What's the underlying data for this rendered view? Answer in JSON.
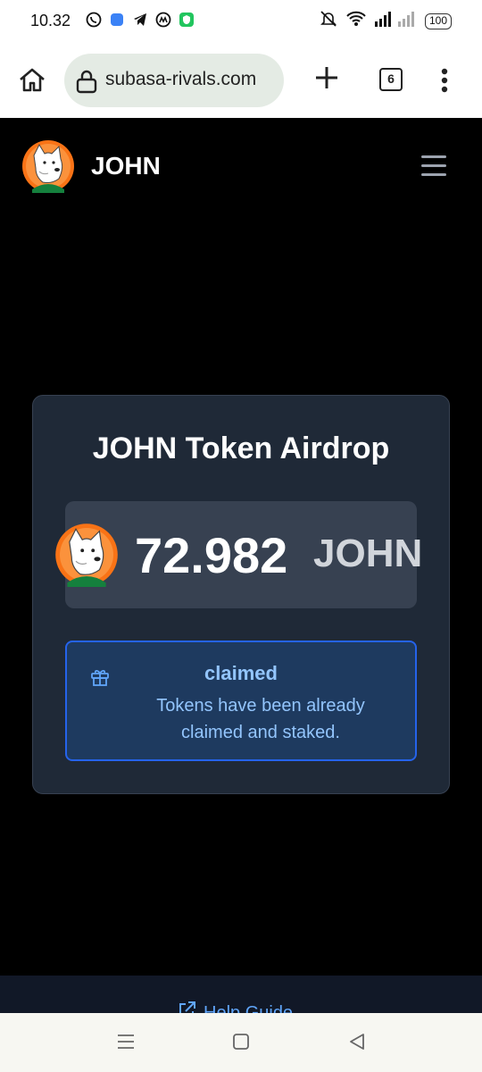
{
  "status_bar": {
    "time": "10.32",
    "battery": "100"
  },
  "browser": {
    "url": "subasa-rivals.com",
    "tab_count": "6"
  },
  "site": {
    "brand": "JOHN"
  },
  "airdrop": {
    "title": "JOHN Token Airdrop",
    "amount": "72.982",
    "unit": "JOHN",
    "status_title": "claimed",
    "status_message": "Tokens have been already claimed and staked."
  },
  "footer": {
    "help_label": "Help Guide"
  },
  "colors": {
    "card_bg": "#1f2937",
    "accent_blue": "#93c5fd",
    "link_blue": "#60a5fa",
    "status_border": "#2563eb"
  },
  "icons": [
    "whatsapp-icon",
    "app-icon",
    "telegram-icon",
    "coinmarketcap-icon",
    "shield-app-icon",
    "mute-icon",
    "wifi-icon",
    "signal-icon",
    "home-icon",
    "lock-icon",
    "plus-icon",
    "more-icon",
    "menu-icon",
    "gift-icon",
    "external-link-icon"
  ]
}
